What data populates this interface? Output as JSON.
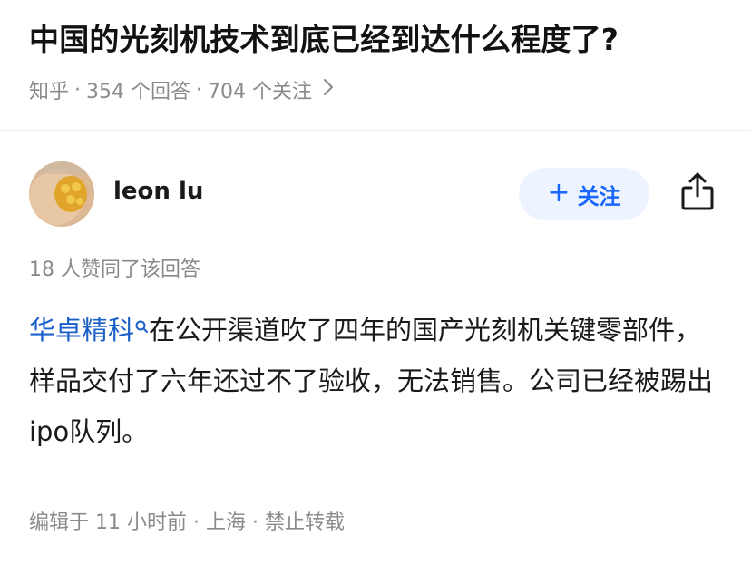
{
  "question": {
    "title": "中国的光刻机技术到底已经到达什么程度了?",
    "source": "知乎",
    "answers": "354 个回答",
    "followers": "704 个关注",
    "separator": " · "
  },
  "author": {
    "name": "leon lu",
    "follow_label": "关注"
  },
  "likes_text": "18 人赞同了该回答",
  "answer": {
    "link_text": "华卓精科",
    "body": "在公开渠道吹了四年的国产光刻机关键零部件，样品交付了六年还过不了验收，无法销售。公司已经被踢出ipo队列。"
  },
  "footer": {
    "text": "编辑于 11 小时前 · 上海 · 禁止转载"
  },
  "colors": {
    "accent": "#1a66ff",
    "link": "#1b5fc9",
    "muted": "#8a8a8a",
    "follow_bg": "#eef4ff"
  },
  "icons": {
    "share": "share-icon",
    "chevron": "chevron-right-icon",
    "search_mark": "search-icon"
  }
}
